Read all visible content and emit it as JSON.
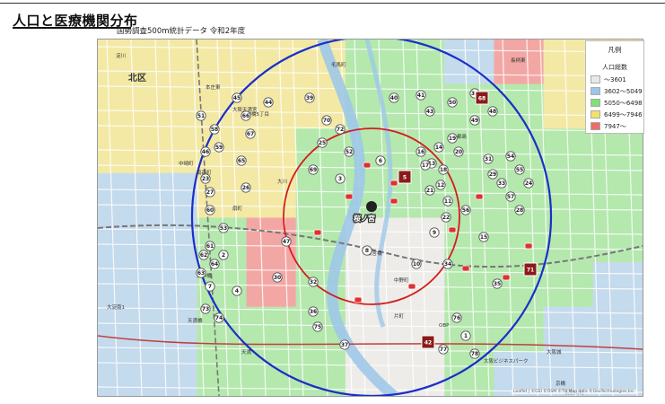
{
  "header": {
    "title": "人口と医療機関分布",
    "subtitle": "国勢調査500m統計データ 令和2年度"
  },
  "legend": {
    "title": "凡例",
    "subtitle": "人口総数",
    "items": [
      {
        "label": "～3601",
        "color": "#e8e8e8"
      },
      {
        "label": "3602～5049",
        "color": "#9cc6ee"
      },
      {
        "label": "5050～6498",
        "color": "#7fe07a"
      },
      {
        "label": "6499～7946",
        "color": "#f2e26b"
      },
      {
        "label": "7947～",
        "color": "#f26a6a"
      }
    ]
  },
  "map": {
    "ward_label": "北区",
    "center_label": "桜ノ宮",
    "attribution": "Leaflet | ©GSI ©OSM ©TH Map data ©GeoTechnologies,Inc.",
    "labels": [
      "大淀南1",
      "中崎町",
      "天満",
      "扇町",
      "南森町",
      "天神橋",
      "天満橋",
      "大阪城",
      "京橋",
      "都島",
      "桜宮橋",
      "中野町",
      "片町",
      "東野田町",
      "毛馬町",
      "長柄東",
      "本庄東",
      "天神橋5丁目",
      "大川",
      "大阪天満宮",
      "淀川",
      "OBP",
      "大阪ビジネスパーク"
    ],
    "large_markers": [
      "68",
      "5",
      "71",
      "42"
    ],
    "markers": [
      "3",
      "6",
      "11",
      "12",
      "13",
      "14",
      "16",
      "17",
      "18",
      "19",
      "20",
      "21",
      "22",
      "23",
      "25",
      "26",
      "27",
      "29",
      "31",
      "33",
      "34",
      "35",
      "36",
      "37",
      "38",
      "39",
      "40",
      "41",
      "43",
      "44",
      "45",
      "46",
      "47",
      "48",
      "49",
      "50",
      "51",
      "52",
      "53",
      "54",
      "55",
      "56",
      "57",
      "58",
      "59",
      "60",
      "61",
      "62",
      "63",
      "64",
      "65",
      "66",
      "67",
      "69",
      "70",
      "72",
      "73",
      "74",
      "75",
      "76",
      "77",
      "78",
      "1",
      "2",
      "4",
      "7",
      "8",
      "9",
      "10",
      "15",
      "24",
      "28",
      "30",
      "32"
    ]
  }
}
